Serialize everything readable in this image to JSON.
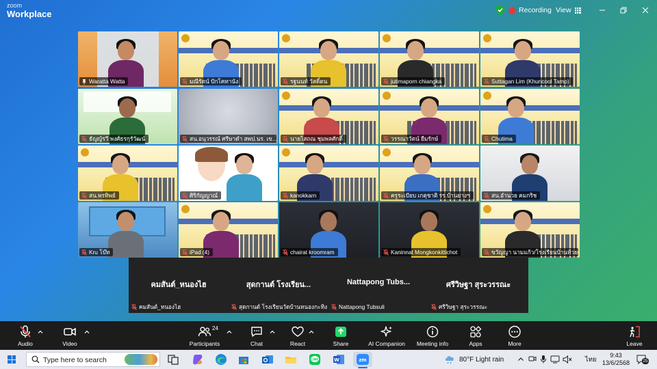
{
  "app": {
    "brand_small": "zoom",
    "brand_big": "Workplace"
  },
  "titlebar": {
    "recording_label": "Recording",
    "view_label": "View"
  },
  "colors": {
    "active_speaker": "#8ee28e",
    "recording": "#e53935",
    "mic_muted": "#e5534b",
    "share_green": "#23d96b",
    "toolbar_bg": "#1c1c1c"
  },
  "video_tiles": [
    {
      "name": "Waratta Watta",
      "muted": false,
      "active": true,
      "kind": "person"
    },
    {
      "name": "มณีรัตน์ ปักโคทานัง",
      "muted": true,
      "active": false,
      "kind": "banner"
    },
    {
      "name": "รฐนนท์ วัสดิ์ตน",
      "muted": true,
      "active": false,
      "kind": "banner"
    },
    {
      "name": "jutimaporn chiangka",
      "muted": true,
      "active": false,
      "kind": "banner"
    },
    {
      "name": "Suttagan Lim (Khuncool Tamp)",
      "muted": true,
      "active": false,
      "kind": "banner"
    },
    {
      "name": "ธัญญ์รวี พงศ์ธรกุรัวัฒน์",
      "muted": true,
      "active": false,
      "kind": "green"
    },
    {
      "name": "สน.อนุวรรณ์ ศรีษาดำ สพป.นร. เข...",
      "muted": true,
      "active": false,
      "kind": "blur"
    },
    {
      "name": "นายไสถณ ชุมพลศักดิ์",
      "muted": true,
      "active": false,
      "kind": "banner"
    },
    {
      "name": "วรรณาวัตน์ ยืมรักษ์",
      "muted": true,
      "active": false,
      "kind": "banner"
    },
    {
      "name": "Chutima",
      "muted": true,
      "active": false,
      "kind": "banner"
    },
    {
      "name": "สน.พรทิพย์",
      "muted": true,
      "active": false,
      "kind": "banner"
    },
    {
      "name": "ศิริกัญญาณ์",
      "muted": true,
      "active": false,
      "kind": "cartoon"
    },
    {
      "name": "kanokkarn",
      "muted": true,
      "active": false,
      "kind": "banner"
    },
    {
      "name": "ครูระเบียบ เกตุชาติ รร.บ้านยางฯ",
      "muted": true,
      "active": false,
      "kind": "banner"
    },
    {
      "name": "สน.อำนวย คมกริช",
      "muted": true,
      "active": false,
      "kind": "room"
    },
    {
      "name": "Kru โบ๊ท",
      "muted": true,
      "active": false,
      "kind": "office"
    },
    {
      "name": "iPad (4)",
      "muted": true,
      "active": false,
      "kind": "banner"
    },
    {
      "name": "chairat kroomram",
      "muted": true,
      "active": false,
      "kind": "dark"
    },
    {
      "name": "Kaninnat Mongkonkittichot",
      "muted": true,
      "active": false,
      "kind": "dark"
    },
    {
      "name": "ขวัญญา นามแก้ว/โรงเรียนบ้านห้วยศก...",
      "muted": true,
      "active": false,
      "kind": "banner"
    }
  ],
  "name_tiles": [
    {
      "display": "คมสันต์_หนองไฮ",
      "label": "คมสันต์_หนองไฮ"
    },
    {
      "display": "สุดกานต์ โรงเรียน...",
      "label": "สุดกานต์ โรงเรียนวัดบ้านหนองกะทิง..."
    },
    {
      "display": "Nattapong  Tubs...",
      "label": "Nattapong Tubsuli"
    },
    {
      "display": "ศรีวิษฐา สุระวรรณะ",
      "label": "ศรีวิษฐา สุระวรรณะ"
    }
  ],
  "toolbar": {
    "audio": "Audio",
    "video": "Video",
    "participants": "Participants",
    "participants_count": "24",
    "chat": "Chat",
    "react": "React",
    "share": "Share",
    "ai": "AI Companion",
    "meeting_info": "Meeting info",
    "apps": "Apps",
    "more": "More",
    "leave": "Leave"
  },
  "taskbar": {
    "search_placeholder": "Type here to search",
    "weather": "80°F  Light rain",
    "lang": "ไทย",
    "time": "9:43",
    "date": "13/6/2568",
    "notif_count": "25"
  }
}
